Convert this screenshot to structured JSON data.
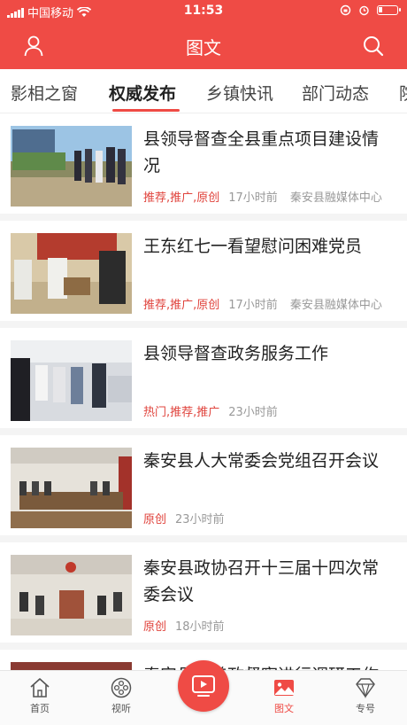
{
  "status_bar": {
    "carrier": "中国移动",
    "time": "11:53"
  },
  "header": {
    "title": "图文"
  },
  "tabs": [
    {
      "label": "影相之窗"
    },
    {
      "label": "权威发布"
    },
    {
      "label": "乡镇快讯"
    },
    {
      "label": "部门动态"
    },
    {
      "label": "院"
    }
  ],
  "active_tab": "权威发布",
  "news": [
    {
      "title": "县领导督查全县重点项目建设情况",
      "tags": "推荐,推广,原创",
      "time": "17小时前",
      "source": "秦安县融媒体中心"
    },
    {
      "title": "王东红七一看望慰问困难党员",
      "tags": "推荐,推广,原创",
      "time": "17小时前",
      "source": "秦安县融媒体中心"
    },
    {
      "title": "县领导督查政务服务工作",
      "tags": "热门,推荐,推广",
      "time": "23小时前",
      "source": ""
    },
    {
      "title": "秦安县人大常委会党组召开会议",
      "tags": "原创",
      "time": "23小时前",
      "source": ""
    },
    {
      "title": " 秦安县政协召开十三届十四次常委会议",
      "tags": "原创",
      "time": "18小时前",
      "source": ""
    },
    {
      "title": "秦安县…普政督察进行调研工作",
      "tags": "",
      "time": "",
      "source": ""
    }
  ],
  "bottom_nav": [
    {
      "label": "首页",
      "icon": "home-icon"
    },
    {
      "label": "视听",
      "icon": "film-reel-icon"
    },
    {
      "label": "",
      "icon": "tv-play-icon"
    },
    {
      "label": "图文",
      "icon": "image-icon"
    },
    {
      "label": "专号",
      "icon": "diamond-icon"
    }
  ],
  "colors": {
    "brand_red": "#ef4b45",
    "tag_red": "#e0443d",
    "meta_gray": "#999999"
  }
}
